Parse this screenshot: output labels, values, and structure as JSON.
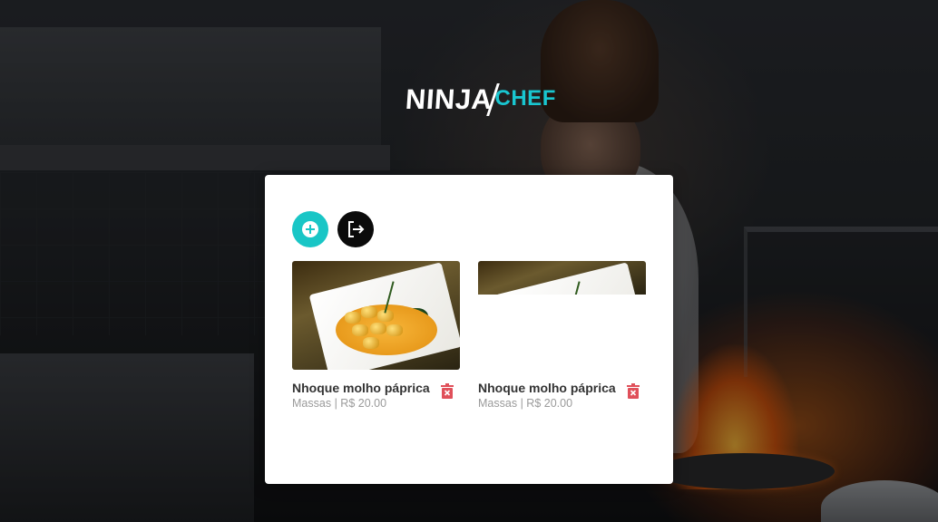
{
  "brand": {
    "logo_ninja": "NINJA",
    "logo_chef": "CHEF",
    "accent_color": "#19c6d0"
  },
  "actions": {
    "add_icon": "plus-circle-icon",
    "logout_icon": "logout-icon"
  },
  "dishes": [
    {
      "name": "Nhoque molho páprica",
      "category": "Massas",
      "separator": "|",
      "price": "R$ 20.00",
      "delete_icon": "trash-icon"
    },
    {
      "name": "Nhoque molho páprica",
      "category": "Massas",
      "separator": "|",
      "price": "R$ 20.00",
      "delete_icon": "trash-icon"
    }
  ],
  "colors": {
    "add_button": "#19c6c6",
    "logout_button": "#0b0b0b",
    "delete": "#e0505a"
  }
}
